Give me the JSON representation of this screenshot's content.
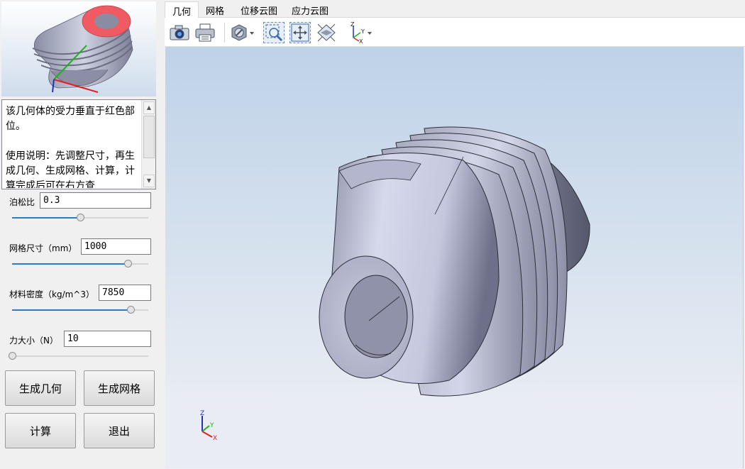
{
  "description": {
    "text": "该几何体的受力垂直于红色部位。\n\n使用说明：先调整尺寸，再生成几何、生成网格、计算，计算完成后可在右方查"
  },
  "params": [
    {
      "label": "泊松比",
      "value": "0.3",
      "slider_fraction": 0.5
    },
    {
      "label": "网格尺寸（mm）",
      "value": "1000",
      "slider_fraction": 0.85
    },
    {
      "label": "材料密度（kg/m^3）",
      "value": "7850",
      "slider_fraction": 0.87
    },
    {
      "label": "力大小（N）",
      "value": "10",
      "slider_fraction": 0.0
    }
  ],
  "buttons": {
    "generate_geometry": "生成几何",
    "generate_mesh": "生成网格",
    "compute": "计算",
    "exit": "退出"
  },
  "tabs": [
    "几何",
    "网格",
    "位移云图",
    "应力云图"
  ],
  "active_tab": "几何",
  "toolbar_icons": [
    "camera-icon",
    "print-icon",
    "hide-icon",
    "zoom-box-icon",
    "fit-all-icon",
    "view-direction-icon",
    "axis-orientation-icon"
  ],
  "axis_labels": {
    "x": "X",
    "y": "Y",
    "z": "Z"
  },
  "colors": {
    "accent": "#2a7fc4",
    "highlight_face": "#f05a63",
    "axis_x": "#e02020",
    "axis_y": "#20b020",
    "axis_z": "#2030c0",
    "model_face": "#b8bbcc"
  }
}
